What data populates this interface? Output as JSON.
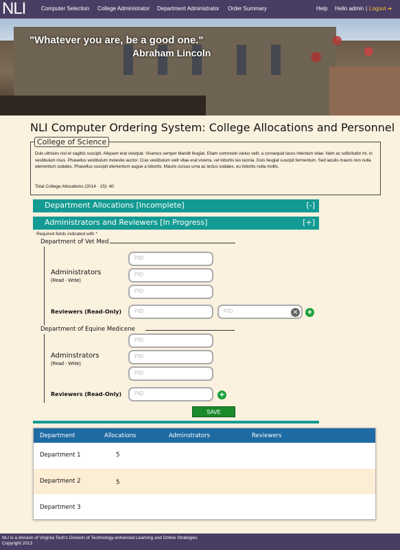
{
  "nav": {
    "logo": "NLI",
    "items": [
      "Computer Selection",
      "College Administrator",
      "Department Administrator",
      "Order Summary"
    ],
    "help": "Help",
    "greeting": "Hello admin",
    "separator": "|",
    "logout": "Logout"
  },
  "hero": {
    "quote": "\"Whatever you are, be a good one.\"",
    "author": "Abraham Lincoln"
  },
  "page_title": "NLI Computer Ordering System: College Allocations and Personnel",
  "college": {
    "name": "College of Science",
    "description": "Duis ultricies nisl et sagittis suscipit. Aliquam erat volutpat. Vivamus semper blandit feugiat. Etiam commodo varius velit, a consequat lacus interdum vitae. Nam ac sollicitudin mi, in vestibulum risus. Phasellus vestibulum molestie auctor. Cras vestibulum velit vitae erat viverra, vel lobortis leo lacinia. Duis feugiat suscipit fermentum. Sed iaculis mauris non nulla elementum sodales. Phasellus suscipit elementum augue a lobortis. Mauris cursus urna ac lectus sodales, eu lobortis nulla mollis.",
    "total": "Total College Allocations (2014 - 15): 40"
  },
  "accordions": [
    {
      "label": "Department Allocations [Incomplete]",
      "toggle": "[-]"
    },
    {
      "label": "Administrators and Reviewers [In Progress]",
      "toggle": "[+]"
    }
  ],
  "required_note": "Required fields indicated with *",
  "departments": [
    {
      "name": "Department of Vet Med",
      "admin_label": "Administrators",
      "admin_sub": "(Read - Write)",
      "reviewers_label": "Reviewers (Read-Only)",
      "placeholder": "PID"
    },
    {
      "name": "Department of Equine Medicene",
      "admin_label": "Adminstrators",
      "admin_sub": "(Read - Write)",
      "reviewers_label": "Reviewers (Read-Only)",
      "placeholder": "PID"
    }
  ],
  "save_label": "SAVE",
  "table": {
    "headers": [
      "Department",
      "Allocations",
      "Adminstrators",
      "Reviewers"
    ],
    "rows": [
      {
        "department": "Department 1",
        "allocations": "5"
      },
      {
        "department": "Department 2",
        "allocations": "5"
      },
      {
        "department": "Department 3",
        "allocations": ""
      }
    ]
  },
  "footer": {
    "line1": "NLI is a division of Virginia Tech's Division of Technology-enhanced Learning and Online Strategies",
    "line2": "Copyright 2013"
  },
  "colors": {
    "nav_bg": "#4a3d63",
    "teal": "#139b93",
    "table_head": "#1e6aa2",
    "save_green": "#1b8a2a",
    "page_bg": "#fbf1df",
    "logout": "#f3c43a"
  },
  "icons": [
    "logout-icon",
    "clear-icon",
    "add-icon"
  ]
}
